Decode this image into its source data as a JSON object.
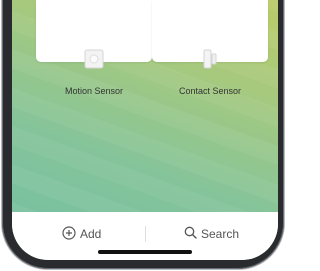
{
  "devices": [
    {
      "label": "Motion Sensor",
      "icon": "motion-sensor-icon"
    },
    {
      "label": "Contact Sensor",
      "icon": "contact-sensor-icon"
    }
  ],
  "bottom_bar": {
    "add_label": "Add",
    "search_label": "Search"
  },
  "colors": {
    "gradient_start": "#74bfa3",
    "gradient_end": "#c5cd5f",
    "frame": "#2a2b2e"
  }
}
